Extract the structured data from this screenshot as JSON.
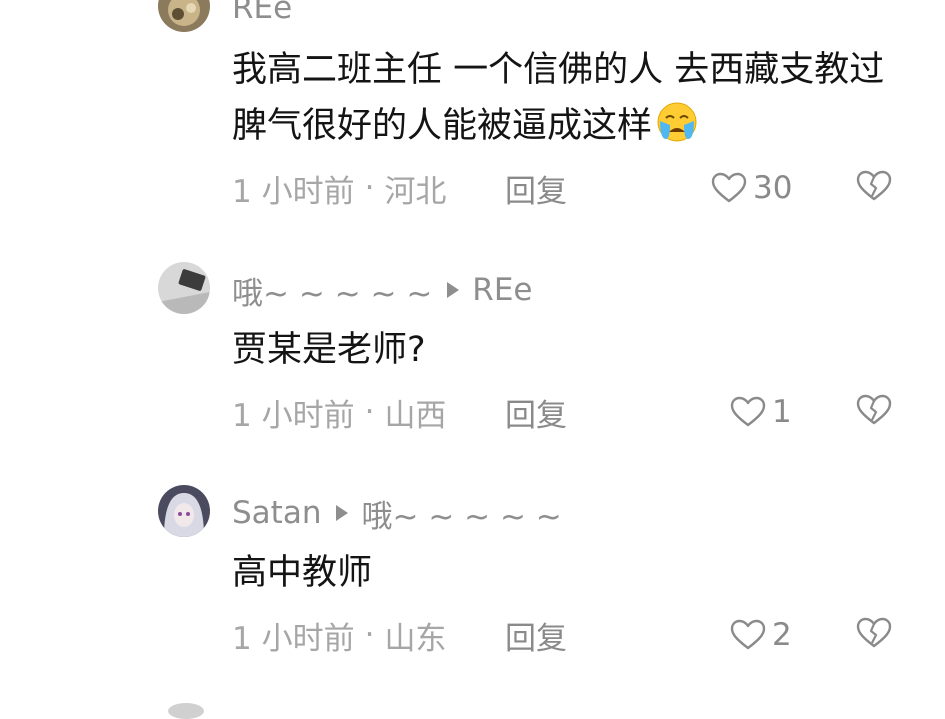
{
  "comments": [
    {
      "author": "REe",
      "reply_to": "",
      "text": "我高二班主任  一个信佛的人 去西藏支教过 脾气很好的人能被逼成这样",
      "emoji": "crying-face",
      "time": "1 小时前",
      "location": "河北",
      "reply_label": "回复",
      "likes": "30"
    },
    {
      "author": "哦~ ~ ~ ~ ~",
      "reply_to": "REe",
      "text": "贾某是老师?",
      "time": "1 小时前",
      "location": "山西",
      "reply_label": "回复",
      "likes": "1"
    },
    {
      "author": "Satan",
      "reply_to": "哦~ ~ ~ ~ ~",
      "text": "高中教师",
      "time": "1 小时前",
      "location": "山东",
      "reply_label": "回复",
      "likes": "2"
    }
  ],
  "separator": "·",
  "colors": {
    "text": "#141414",
    "secondary": "#8e8e8e",
    "meta": "#a6a6a6"
  }
}
